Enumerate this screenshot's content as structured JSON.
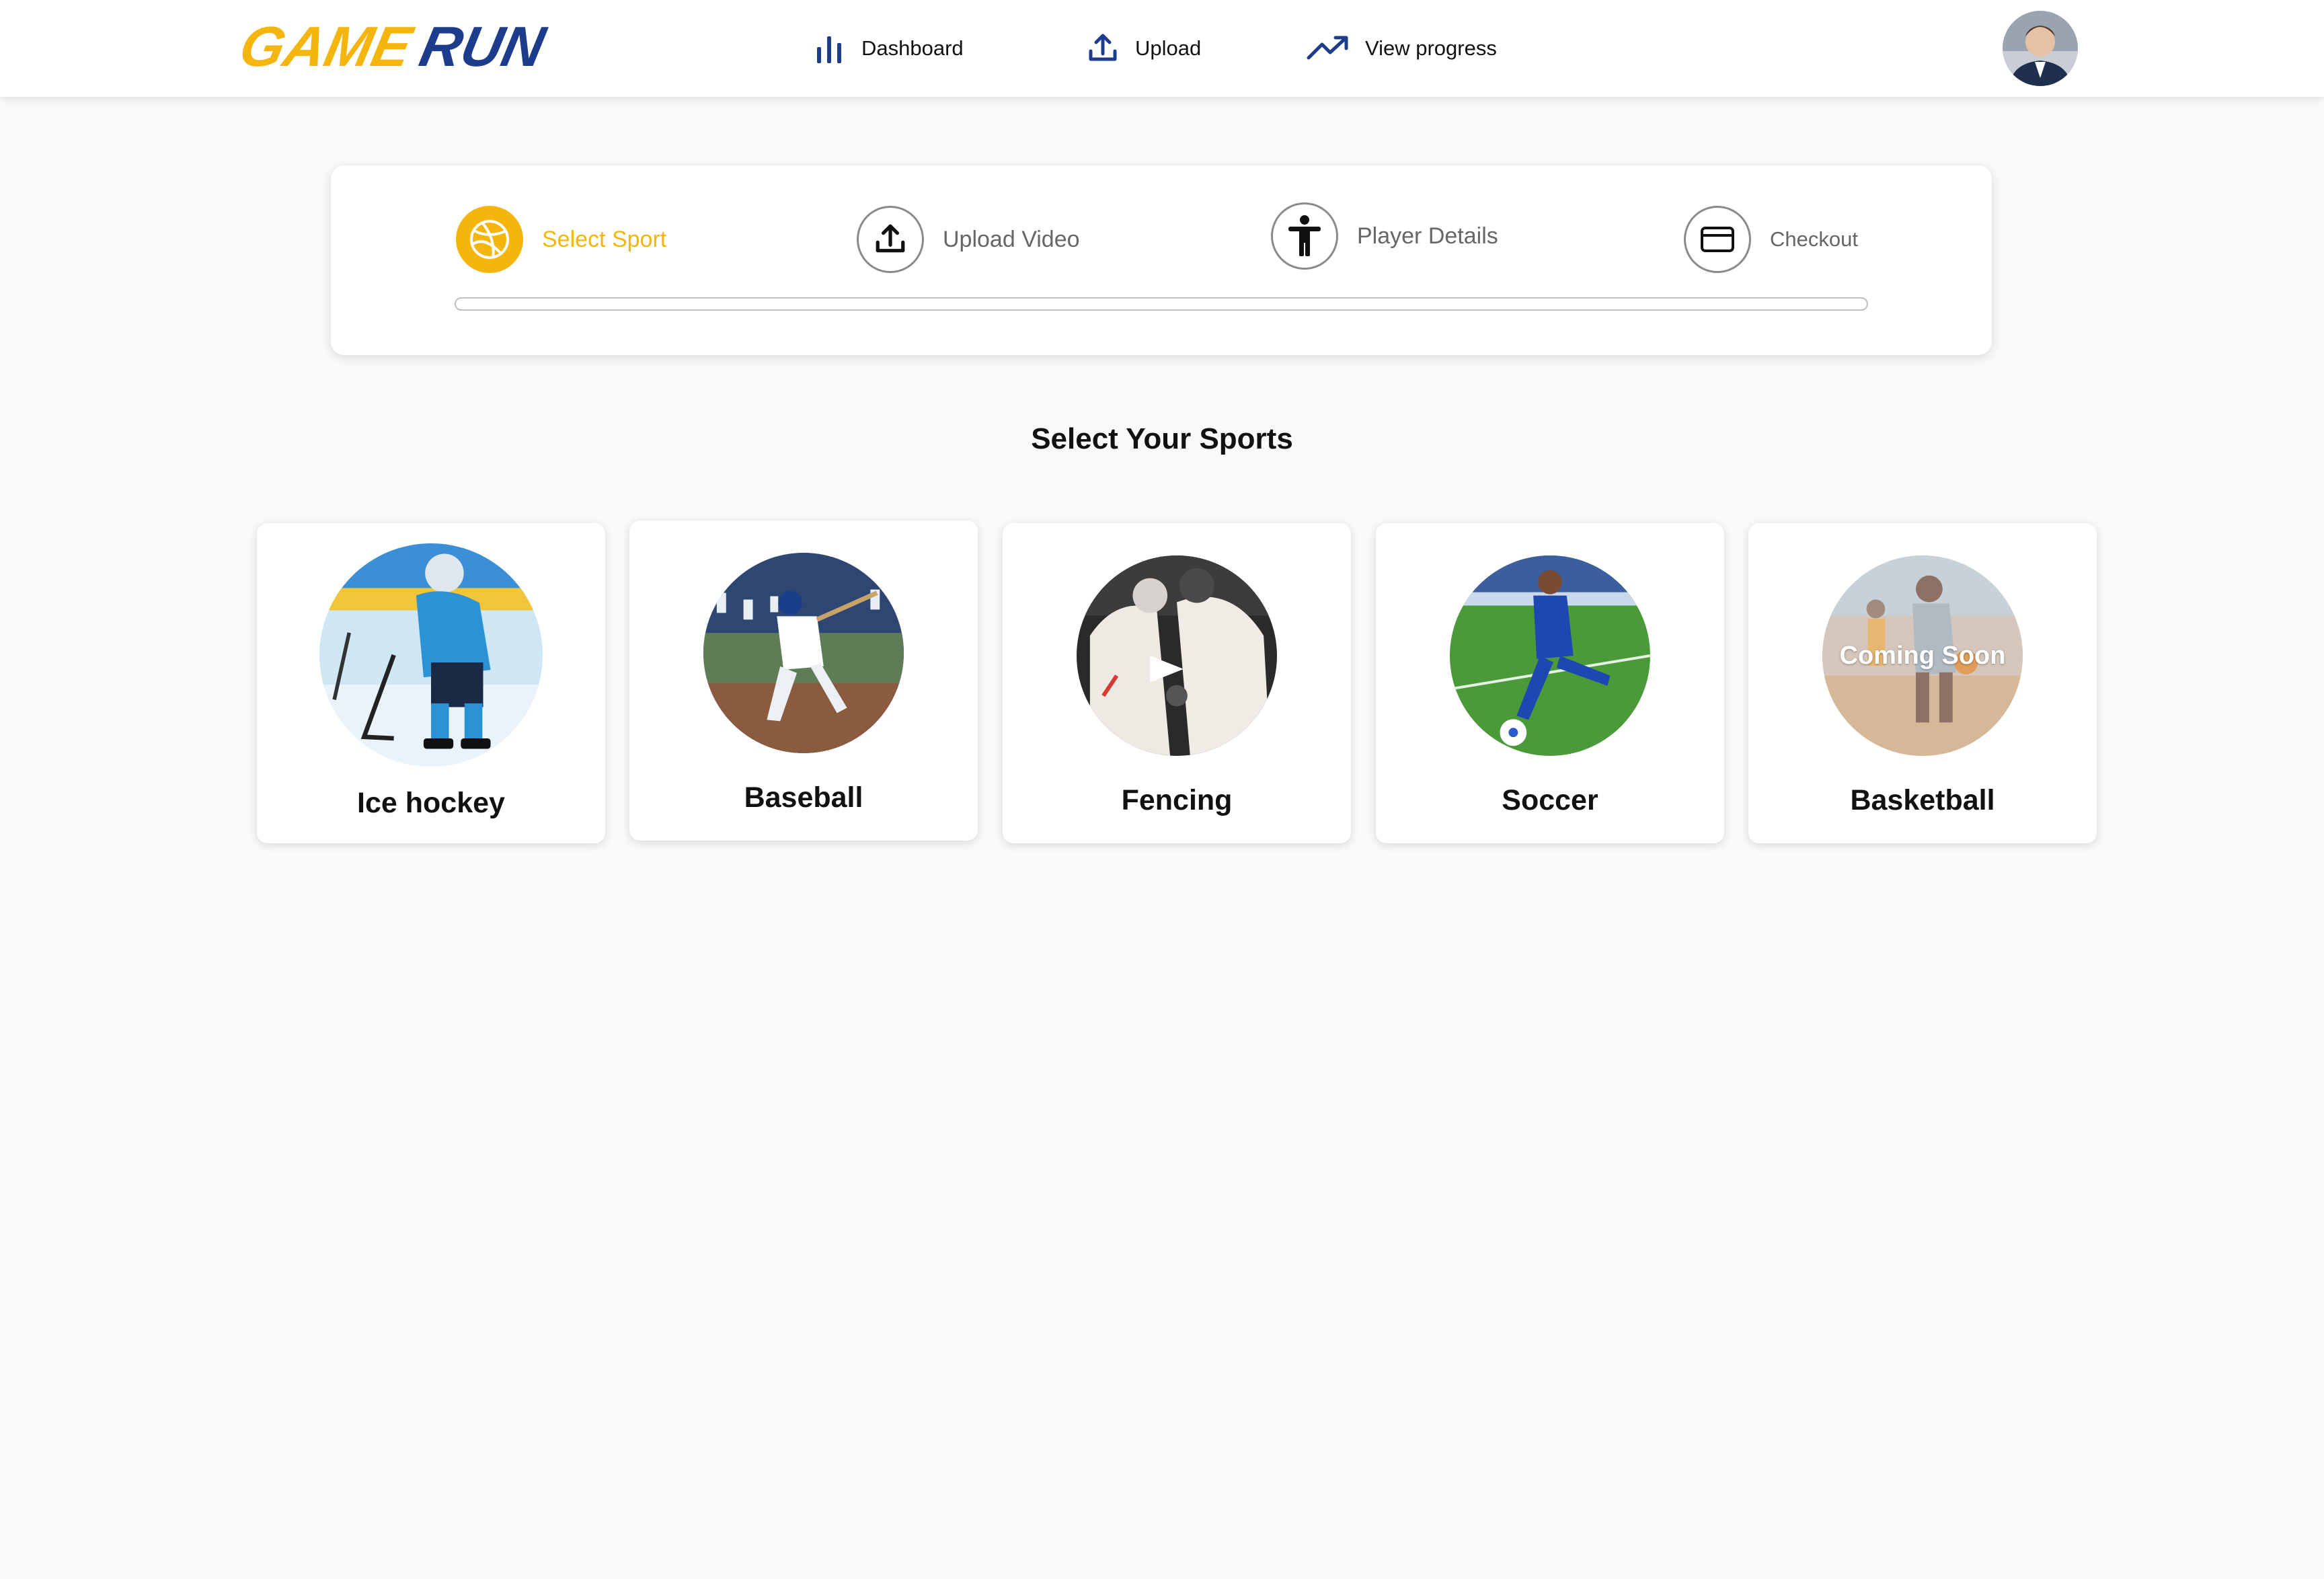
{
  "brand": {
    "logo_text": "GAMERUN",
    "primary_color": "#f5b50f",
    "secondary_color": "#1e3c8c"
  },
  "nav": {
    "items": [
      {
        "label": "Dashboard",
        "icon": "bar-chart-icon"
      },
      {
        "label": "Upload",
        "icon": "upload-icon"
      },
      {
        "label": "View progress",
        "icon": "trending-up-icon"
      }
    ]
  },
  "user": {
    "avatar_icon": "user-avatar"
  },
  "stepper": {
    "steps": [
      {
        "label": "Select Sport",
        "icon": "basketball-icon",
        "active": true
      },
      {
        "label": "Upload Video",
        "icon": "upload-icon",
        "active": false
      },
      {
        "label": "Player Details",
        "icon": "person-icon",
        "active": false
      },
      {
        "label": "Checkout",
        "icon": "credit-card-icon",
        "active": false
      }
    ],
    "progress": 0
  },
  "section_title": "Select Your Sports",
  "sports": [
    {
      "name": "Ice hockey",
      "image": "ice-hockey-photo"
    },
    {
      "name": "Baseball",
      "image": "baseball-photo"
    },
    {
      "name": "Fencing",
      "image": "fencing-photo"
    },
    {
      "name": "Soccer",
      "image": "soccer-photo"
    },
    {
      "name": "Basketball",
      "image": "basketball-photo",
      "overlay": "Coming Soon"
    }
  ]
}
